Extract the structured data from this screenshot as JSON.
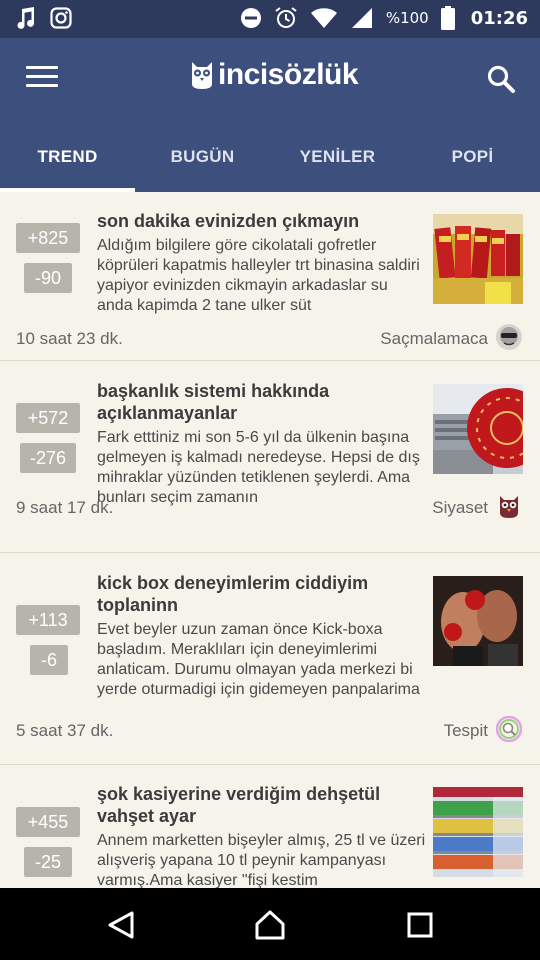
{
  "status_bar": {
    "icons": [
      "music-note-icon",
      "instagram-icon",
      "do-not-disturb-icon",
      "alarm-icon",
      "wifi-icon",
      "signal-icon",
      "battery-icon"
    ],
    "battery": "%100",
    "time": "01:26"
  },
  "app": {
    "logo_text": "incisözlük",
    "menu_icon": "hamburger-menu-icon",
    "search_icon": "search-icon"
  },
  "tabs": [
    {
      "label": "TREND",
      "active": true
    },
    {
      "label": "BUGÜN",
      "active": false
    },
    {
      "label": "YENİLER",
      "active": false
    },
    {
      "label": "POPİ",
      "active": false
    }
  ],
  "posts": [
    {
      "up": "+825",
      "down": "-90",
      "title": "son dakika evinizden çıkmayın",
      "excerpt": "Aldığım bilgilere göre cikolatali gofretler köprüleri kapatmis halleyler trt binasina saldiri yapiyor evinizden cikmayin arkadaslar su anda kapimda 2 tane ulker süt",
      "time": "10 saat 23 dk.",
      "category": "Saçmalamaca"
    },
    {
      "up": "+572",
      "down": "-276",
      "title": "başkanlık sistemi hakkında açıklanmayanlar",
      "excerpt": "Fark etttiniz mi son 5-6 yıl da ülkenin başına gelmeyen iş kalmadı neredeyse. Hepsi de dış mihraklar yüzünden tetiklenen şeylerdi. Ama bunları seçim zamanın",
      "time": "9 saat 17 dk.",
      "category": "Siyaset"
    },
    {
      "up": "+113",
      "down": "-6",
      "title": "kick box deneyimlerim ciddiyim toplaninn",
      "excerpt": "Evet beyler uzun zaman önce Kick-boxa başladım. Meraklıları için deneyimlerimi anlaticam. Durumu olmayan yada merkezi bi yerde oturmadigi için gidemeyen panpalarima",
      "time": "5 saat 37 dk.",
      "category": "Tespit"
    },
    {
      "up": "+455",
      "down": "-25",
      "title": "şok kasiyerine verdiğim dehşetül vahşet ayar",
      "excerpt": "Annem marketten bişeyler almış, 25 tl ve üzeri alışveriş yapana 10 tl peynir kampanyası varmış.Ama kasiyer \"fişi kestim",
      "time": "",
      "category": ""
    }
  ],
  "nav": {
    "icons": [
      "back-icon",
      "home-icon",
      "recents-icon"
    ]
  }
}
